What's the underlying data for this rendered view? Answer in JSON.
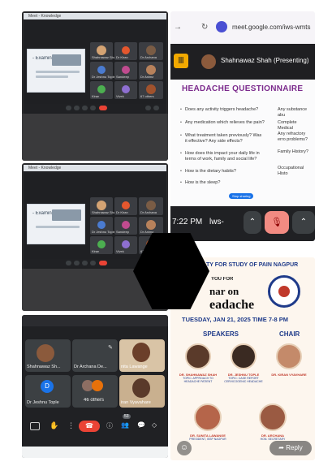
{
  "meet": {
    "url": "meet.google.com/iws-wmts",
    "presenter_label": "Shahnawaz Shah (Presenting)",
    "presenter_initial": "D",
    "time": "7:22 PM",
    "meeting_code": "lws-",
    "slide_left_label": "- Examination",
    "window_tab": "Meet - Knowledge"
  },
  "questionnaire": {
    "title": "HEADACHE QUESTIONNAIRE",
    "items_left": [
      "Does any activity triggers headache?",
      "Any medication which relieves the pain?",
      "What treatment taken previously? Was it effective? Any side effects?",
      "How does this impact your daily life in terms of work, family and social life?",
      "How is the dietary habits?",
      "How is the sleep?"
    ],
    "items_right": [
      "Any substance abu",
      "Complete Medical",
      "Any refractory erro problems?",
      "Family History?",
      "Occupational Histo"
    ],
    "button": "Stop sharing"
  },
  "participants": {
    "names": [
      "Shahnawaz Sh...",
      "Dr Archana De...",
      "nita Lawange",
      "Dr Jeshnu Tople",
      "46 others",
      "iran Vyavahare"
    ],
    "initial": "D",
    "others_count_label": "46 others",
    "badge_count": "53"
  },
  "laptop_cells": {
    "row1": [
      "Shahnawaz Shah",
      "Dr Kiran",
      "Dr Archana"
    ],
    "row2": [
      "Dr Jeshnu Tople",
      "Sandeep",
      "Dr Anima"
    ],
    "row3": [
      "Kiran",
      "Vivek",
      "67 others"
    ]
  },
  "poster": {
    "org": "TY FOR STUDY OF PAIN NAGPUR",
    "invite": "YOU FOR",
    "event1": "nar on",
    "event2": "eadache",
    "date": "TUESDAY, JAN 21, 2025 TIME 7-8 PM",
    "speakers_heading": "SPEAKERS",
    "chair_heading": "CHAIR",
    "speakers": [
      {
        "name": "DR. SHAHNAWAZ SHAH",
        "topic": "TOPIC: APPROACH TO HEADACHE PATIENT"
      },
      {
        "name": "DR. JESHNU TOPLE",
        "topic": "TOPIC: CASE REPORT CERVICOGENIC HEADACHE"
      },
      {
        "name": "DR. KIRAN VYAVHARE",
        "topic": ""
      }
    ],
    "bottom_people": [
      {
        "name": "DR. SUNITA LAWANGE",
        "topic": "PRESIDENT, ISSP NAGPUR"
      },
      {
        "name": "DR. ARCHANA",
        "topic": "HON. SECRETARY"
      }
    ],
    "reply_label": "Reply"
  },
  "colors": {
    "meet_red": "#ea4335",
    "title_purple": "#7b2a8c",
    "poster_blue": "#1f3b8a",
    "chair_red": "#c0392b"
  }
}
